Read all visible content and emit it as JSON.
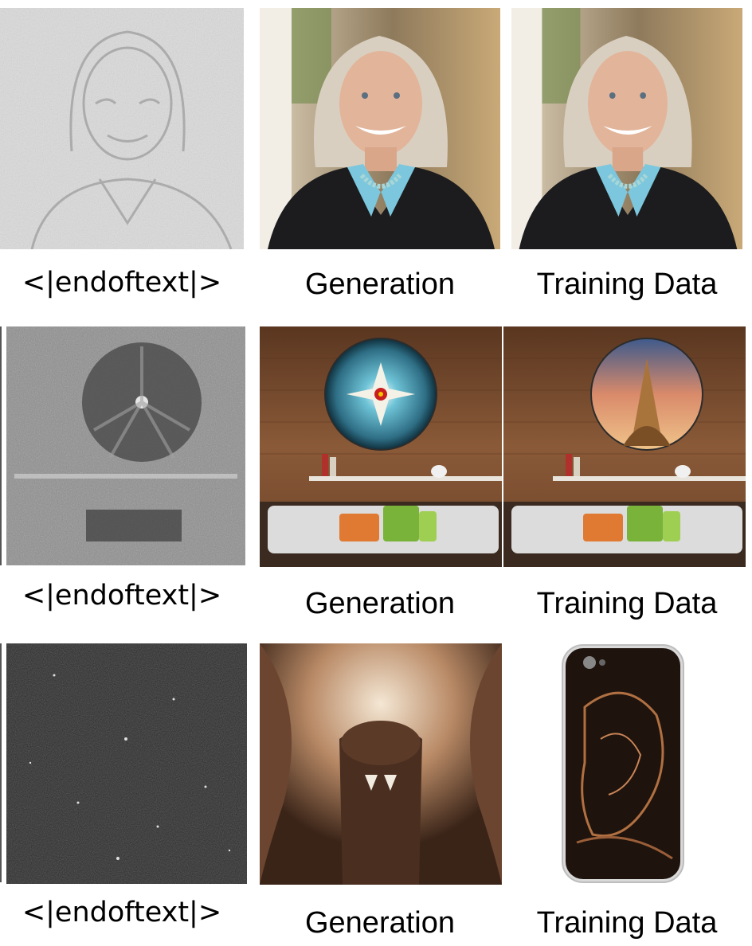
{
  "rows": [
    {
      "prompt_label": "<|endoftext|>",
      "generation_label": "Generation",
      "training_label": "Training Data"
    },
    {
      "prompt_label": "<|endoftext|>",
      "generation_label": "Generation",
      "training_label": "Training Data"
    },
    {
      "prompt_label": "<|endoftext|>",
      "generation_label": "Generation",
      "training_label": "Training Data"
    }
  ],
  "colors": {
    "background": "#ffffff",
    "text": "#000000",
    "jacket": "#1c1c1e",
    "collar": "#7cc7dd",
    "hair": "#d9cfc0",
    "wood_wall": "#7a4a2c",
    "sofa": "#dcdcdc",
    "pillow_orange": "#e07a32",
    "pillow_green": "#7ab33a",
    "sculpture_bronze": "#8a5a3a"
  }
}
